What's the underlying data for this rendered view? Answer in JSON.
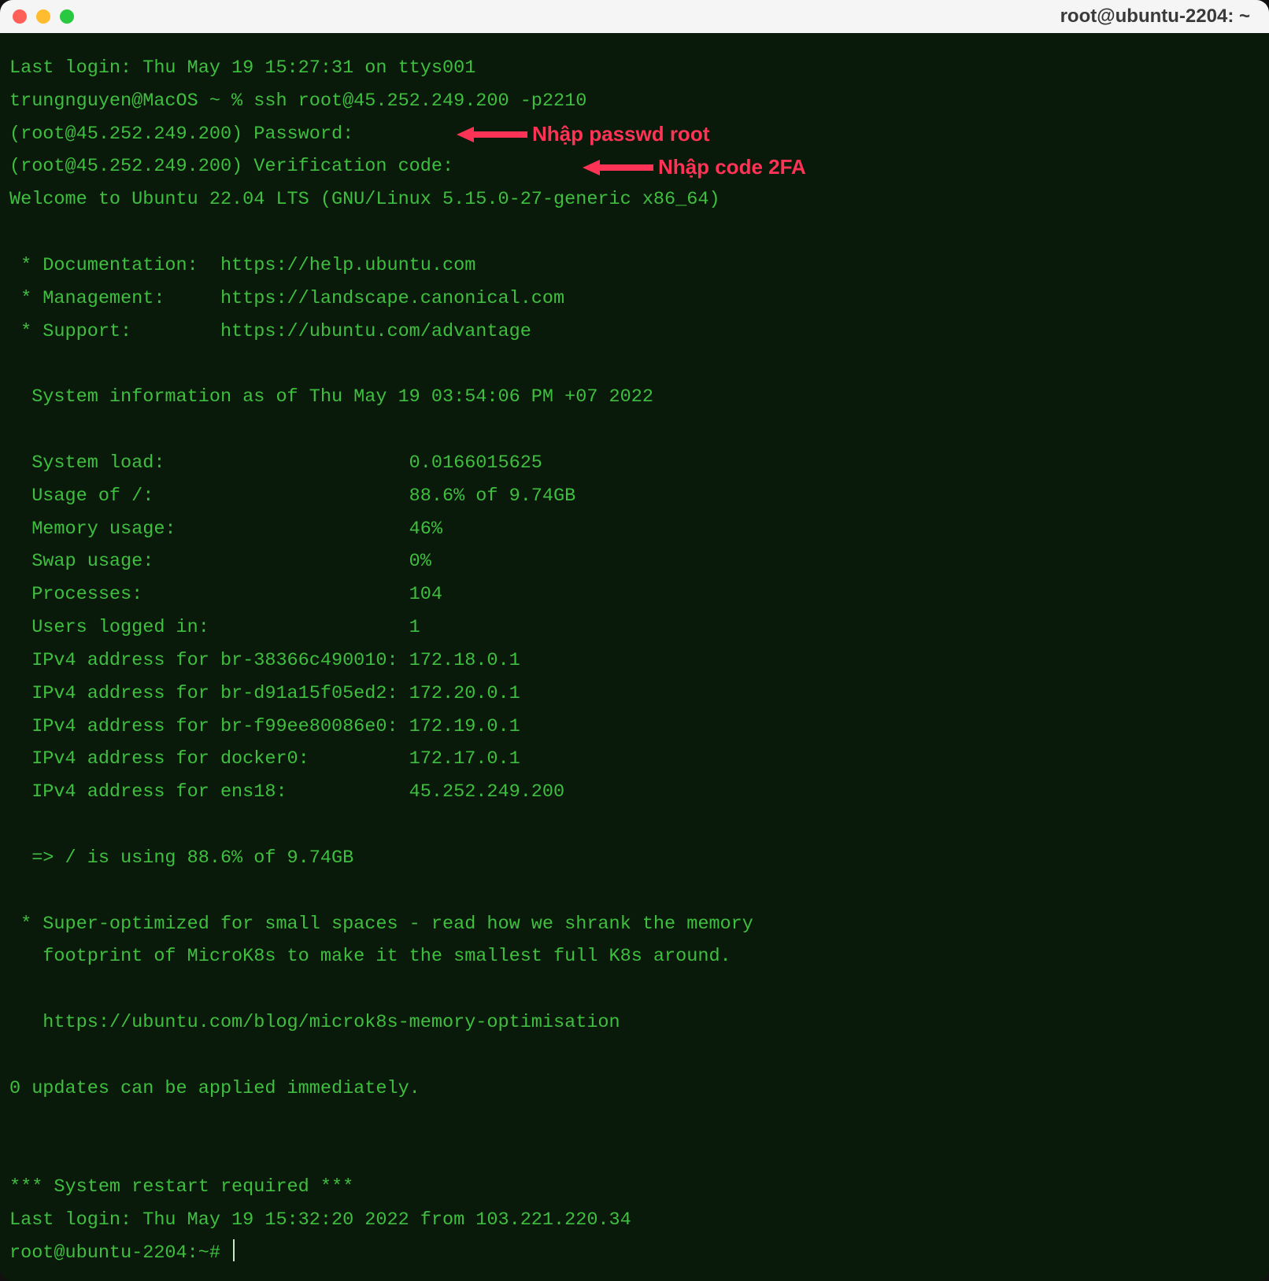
{
  "window": {
    "title": "root@ubuntu-2204: ~"
  },
  "term": {
    "last_login_top": "Last login: Thu May 19 15:27:31 on ttys001",
    "local_prompt": "trungnguyen@MacOS ~ % ssh root@45.252.249.200 -p2210",
    "password_prompt": "(root@45.252.249.200) Password:",
    "verify_prompt": "(root@45.252.249.200) Verification code:",
    "welcome": "Welcome to Ubuntu 22.04 LTS (GNU/Linux 5.15.0-27-generic x86_64)",
    "links": {
      "doc": " * Documentation:  https://help.ubuntu.com",
      "mgmt": " * Management:     https://landscape.canonical.com",
      "support": " * Support:        https://ubuntu.com/advantage"
    },
    "sysinfo_header": "  System information as of Thu May 19 03:54:06 PM +07 2022",
    "sysinfo_rows": [
      "  System load:                      0.0166015625",
      "  Usage of /:                       88.6% of 9.74GB",
      "  Memory usage:                     46%",
      "  Swap usage:                       0%",
      "  Processes:                        104",
      "  Users logged in:                  1",
      "  IPv4 address for br-38366c490010: 172.18.0.1",
      "  IPv4 address for br-d91a15f05ed2: 172.20.0.1",
      "  IPv4 address for br-f99ee80086e0: 172.19.0.1",
      "  IPv4 address for docker0:         172.17.0.1",
      "  IPv4 address for ens18:           45.252.249.200"
    ],
    "usage_warn": "  => / is using 88.6% of 9.74GB",
    "blurb1": " * Super-optimized for small spaces - read how we shrank the memory",
    "blurb2": "   footprint of MicroK8s to make it the smallest full K8s around.",
    "blurb_link": "   https://ubuntu.com/blog/microk8s-memory-optimisation",
    "updates": "0 updates can be applied immediately.",
    "restart": "*** System restart required ***",
    "last_login_remote": "Last login: Thu May 19 15:32:20 2022 from 103.221.220.34",
    "shell_prompt": "root@ubuntu-2204:~# "
  },
  "annotations": {
    "passwd": "Nhập passwd root",
    "twofa": "Nhập code 2FA"
  },
  "colors": {
    "annotation": "#ff3355",
    "term_fg": "#3fbf3f",
    "term_bg": "#0a1a0a"
  }
}
